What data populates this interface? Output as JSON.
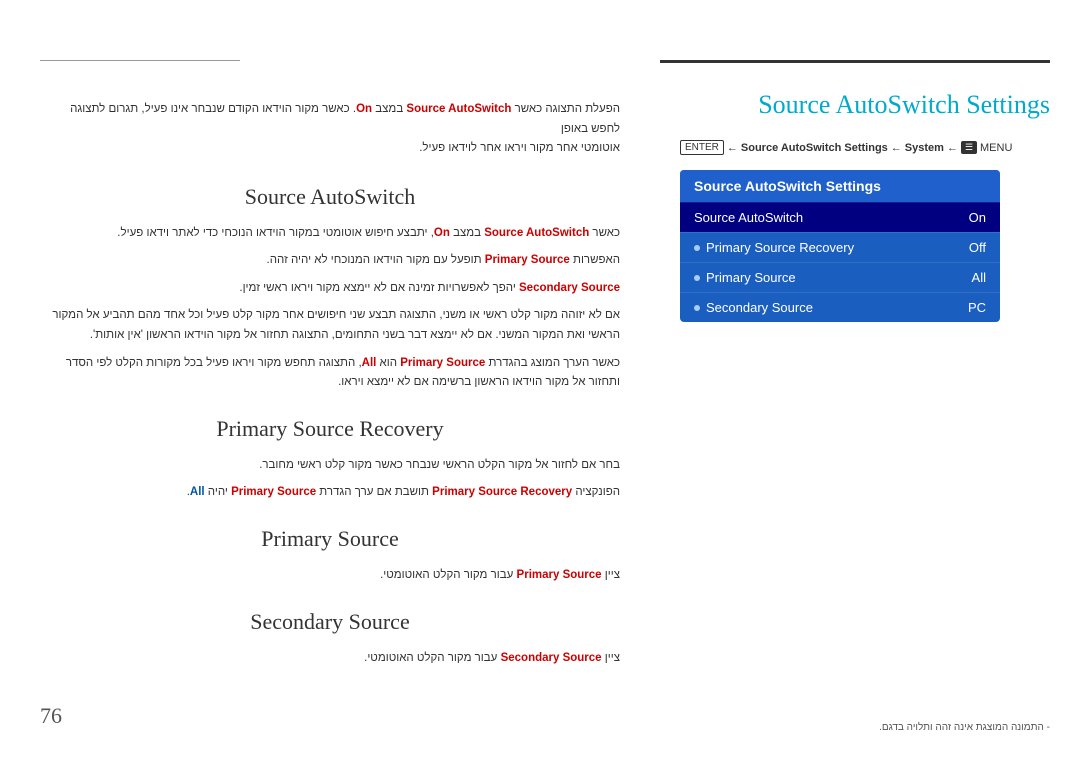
{
  "page": {
    "number": "76"
  },
  "header": {
    "title": "Source AutoSwitch Settings"
  },
  "breadcrumb": {
    "enter": "ENTER",
    "arrow1": "←",
    "crumb1": "Source AutoSwitch Settings",
    "arrow2": "←",
    "crumb2": "System",
    "arrow3": "←",
    "menu": "MENU"
  },
  "menu_box": {
    "title": "Source AutoSwitch Settings",
    "items": [
      {
        "label": "Source AutoSwitch",
        "value": "On",
        "selected": true,
        "dot": false
      },
      {
        "label": "Primary Source Recovery",
        "value": "Off",
        "selected": false,
        "dot": true
      },
      {
        "label": "Primary Source",
        "value": "All",
        "selected": false,
        "dot": true
      },
      {
        "label": "Secondary Source",
        "value": "PC",
        "selected": false,
        "dot": true
      }
    ]
  },
  "intro_text": {
    "line1": "הפעלת התצוגה כאשר Source AutoSwitch במצב On. כאשר מקור הוידאו הקודם שנבחר אינו פעיל, תגרום לתצוגה לחפש באופן",
    "line2": "אוטומטי אחר מקור ויראו אחר לוידאו פעיל."
  },
  "sections": [
    {
      "id": "source-autoswitch",
      "title": "Source AutoSwitch",
      "paragraphs": [
        "כאשר Source AutoSwitch במצב On, יתבצע חיפוש אוטומטי במקור הוידאו הנוכחי כדי לאתר וידאו פעיל.",
        "האפשרות Primary Source תופעל עם מקור הוידאו המנוכחי לא יהיה זהה.",
        "Secondary Source יהפך לאפשרויות זמינה אם לא יימצא מקור ויראו ראשי זמין.",
        "אם לא יזוהה מקור קלט ראשי או משני, התצוגה תבצע שני חיפושים אחר מקור קלט פעיל וכל אחד מהם תהביע אל המקור הראשי ואת המקור המשני. אם לא יימצא דבר בשני התחומים, התצוגה תחזור אל מקור הוידאו הראשון 'אין אותות'.",
        "כאשר הערך המוצג בהגדרת Primary Source הוא All, התצוגה תחפש מקור ויראו פעיל בכל מקורות הקלט לפי הסדר ותחזור אל מקור הוידאו הראשון ברשימה אם לא יימצא ויראו."
      ]
    },
    {
      "id": "primary-source-recovery",
      "title": "Primary Source Recovery",
      "paragraphs": [
        "בחר אם לחזור אל מקור הקלט הראשי שנבחר כאשר מקור קלט ראשי מחובר.",
        "הפונקציה Primary Source Recovery תושבת אם ערך הגדרת Primary Source יהיה All."
      ]
    },
    {
      "id": "primary-source",
      "title": "Primary Source",
      "paragraphs": [
        "ציין Primary Source עבור מקור הקלט האוטומטי."
      ]
    },
    {
      "id": "secondary-source",
      "title": "Secondary Source",
      "paragraphs": [
        "ציין Secondary Source עבור מקור הקלט האוטומטי."
      ]
    }
  ],
  "disclaimer": "- התמונה המוצגת אינה זהה ותלויה בדגם."
}
